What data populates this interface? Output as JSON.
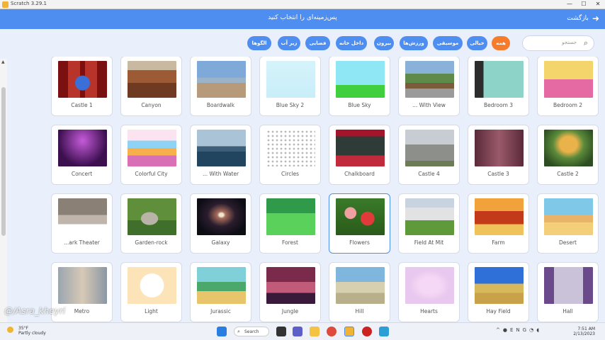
{
  "window": {
    "title": "Scratch 3.29.1",
    "minimize": "—",
    "maximize": "☐",
    "close": "✕"
  },
  "header": {
    "title": "پس‌زمینه‌ای را انتخاب کنید",
    "back_label": "بازگشت",
    "back_icon": "arrow-right-icon"
  },
  "search": {
    "placeholder": "جستجو",
    "icon": "search-icon"
  },
  "filters": [
    {
      "label": "همه",
      "active": true
    },
    {
      "label": "خیالی",
      "active": false
    },
    {
      "label": "موسیقی",
      "active": false
    },
    {
      "label": "ورزش‌ها",
      "active": false
    },
    {
      "label": "بیرون",
      "active": false
    },
    {
      "label": "داخل خانه",
      "active": false
    },
    {
      "label": "فضایی",
      "active": false
    },
    {
      "label": "زیر آب",
      "active": false
    },
    {
      "label": "الگوها",
      "active": false
    }
  ],
  "backdrops": [
    [
      {
        "label": "Castle 1",
        "theme": "castle1"
      },
      {
        "label": "Canyon",
        "theme": "canyon"
      },
      {
        "label": "Boardwalk",
        "theme": "boardwalk"
      },
      {
        "label": "Blue Sky 2",
        "theme": "bluesky2"
      },
      {
        "label": "Blue Sky",
        "theme": "bluesky"
      },
      {
        "label": "... With View",
        "theme": "withview"
      },
      {
        "label": "Bedroom 3",
        "theme": "bedroom3"
      },
      {
        "label": "Bedroom 2",
        "theme": "bedroom2"
      }
    ],
    [
      {
        "label": "Concert",
        "theme": "concert"
      },
      {
        "label": "Colorful City",
        "theme": "colorfulcity"
      },
      {
        "label": "... With Water",
        "theme": "withwater"
      },
      {
        "label": "Circles",
        "theme": "circles"
      },
      {
        "label": "Chalkboard",
        "theme": "chalkboard"
      },
      {
        "label": "Castle 4",
        "theme": "castle4"
      },
      {
        "label": "Castle 3",
        "theme": "castle3"
      },
      {
        "label": "Castle 2",
        "theme": "castle2"
      }
    ],
    [
      {
        "label": "...ark Theater",
        "theme": "theater"
      },
      {
        "label": "Garden-rock",
        "theme": "gardenrock"
      },
      {
        "label": "Galaxy",
        "theme": "galaxy"
      },
      {
        "label": "Forest",
        "theme": "forest"
      },
      {
        "label": "Flowers",
        "theme": "flowers",
        "selected": true
      },
      {
        "label": "Field At Mit",
        "theme": "fieldmit"
      },
      {
        "label": "Farm",
        "theme": "farm"
      },
      {
        "label": "Desert",
        "theme": "desert"
      }
    ],
    [
      {
        "label": "Metro",
        "theme": "metro"
      },
      {
        "label": "Light",
        "theme": "light"
      },
      {
        "label": "Jurassic",
        "theme": "jurassic"
      },
      {
        "label": "Jungle",
        "theme": "jungle"
      },
      {
        "label": "Hill",
        "theme": "hill"
      },
      {
        "label": "Hearts",
        "theme": "hearts"
      },
      {
        "label": "Hay Field",
        "theme": "hayfield"
      },
      {
        "label": "Hall",
        "theme": "hall"
      }
    ]
  ],
  "taskbar": {
    "weather_temp": "35°F",
    "weather_desc": "Partly cloudy",
    "search_label": "Search",
    "time": "7:51 AM",
    "date": "2/13/2023",
    "tray_lang": "ENG"
  },
  "watermark": "@/Asra_kheyri"
}
